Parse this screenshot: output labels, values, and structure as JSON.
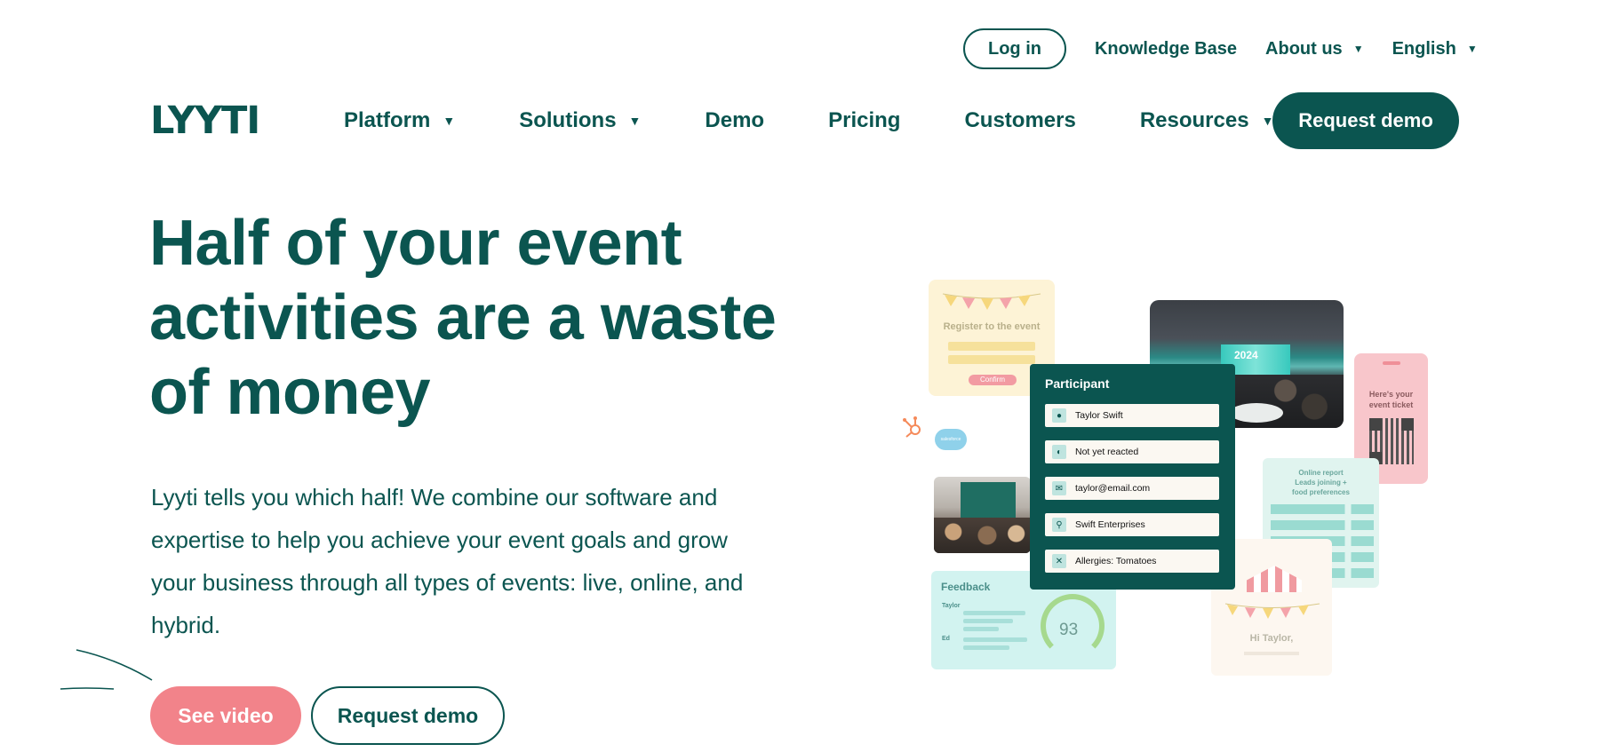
{
  "topbar": {
    "login": "Log in",
    "knowledge_base": "Knowledge Base",
    "about_us": "About us",
    "language": "English"
  },
  "logo": {
    "text": "LYYTI"
  },
  "nav": {
    "items": [
      {
        "label": "Platform",
        "has_dropdown": true
      },
      {
        "label": "Solutions",
        "has_dropdown": true
      },
      {
        "label": "Demo",
        "has_dropdown": false
      },
      {
        "label": "Pricing",
        "has_dropdown": false
      },
      {
        "label": "Customers",
        "has_dropdown": false
      },
      {
        "label": "Resources",
        "has_dropdown": true
      }
    ],
    "cta": "Request demo"
  },
  "hero": {
    "title_lines": [
      "Half of your event",
      "activities are a waste",
      "of money"
    ],
    "subtitle_lines": [
      "Lyyti tells you which half! We combine our software and",
      "expertise to help you achieve your event goals and grow",
      "your business through all types of events: live, online, and",
      "hybrid."
    ],
    "see_video": "See video",
    "request_demo": "Request demo"
  },
  "illustration": {
    "register": {
      "title": "Register to the event",
      "button": "Confirm"
    },
    "ticket": {
      "line1": "Here's your",
      "line2": "event ticket"
    },
    "participant": {
      "title": "Participant",
      "rows": [
        {
          "icon": "person-icon",
          "text": "Taylor Swift"
        },
        {
          "icon": "status-icon",
          "text": "Not yet reacted"
        },
        {
          "icon": "mail-icon",
          "text": "taylor@email.com"
        },
        {
          "icon": "search-icon",
          "text": "Swift Enterprises"
        },
        {
          "icon": "utensils-icon",
          "text": "Allergies: Tomatoes"
        }
      ]
    },
    "report": {
      "line1": "Online report",
      "line2": "Leads joining +",
      "line3": "food preferences"
    },
    "feedback": {
      "title": "Feedback",
      "name1": "Taylor",
      "name2": "Ed",
      "score": "93"
    },
    "greeting": {
      "text": "Hi Taylor,"
    },
    "photo_year": "2024",
    "salesforce": "salesforce"
  },
  "colors": {
    "brand": "#0b5550",
    "accent_pink": "#f2838a",
    "background": "#ffffff"
  }
}
